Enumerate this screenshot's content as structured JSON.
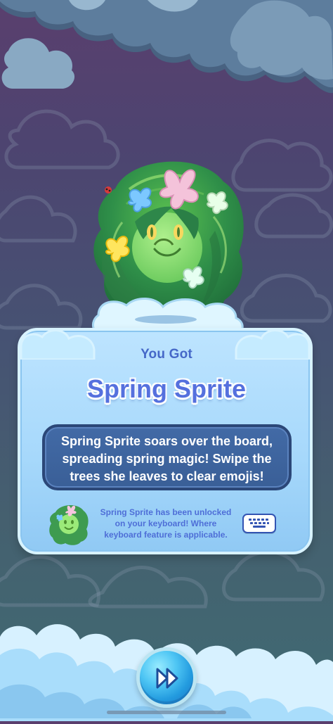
{
  "reward_dialog": {
    "heading": "You Got",
    "item_name": "Spring Sprite",
    "description": "Spring Sprite soars over the board, spreading spring magic! Swipe the trees she leaves to clear emojis!",
    "keyboard_unlock_message": "Spring Sprite has been unlocked on your keyboard! Where keyboard feature is applicable."
  },
  "icons": {
    "character": "spring-sprite",
    "small_character": "spring-sprite",
    "keyboard": "keyboard-icon",
    "skip": "fast-forward-icon"
  },
  "colors": {
    "background_top": "#5a3f6e",
    "background_bottom": "#3f6b73",
    "panel": "#a6d8fb",
    "description_box": "#3a5f97",
    "title_text": "#5570de",
    "skip_button": "#239bdf"
  }
}
